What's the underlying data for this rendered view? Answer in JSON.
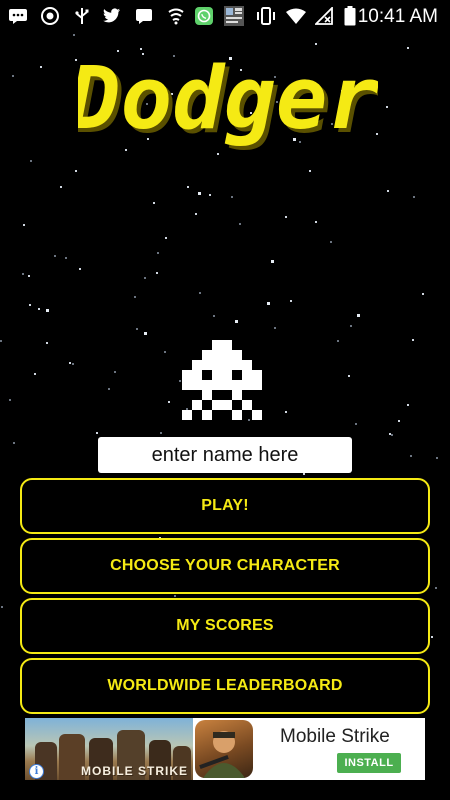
{
  "status_bar": {
    "time": "10:41 AM",
    "icons": [
      "messages-icon",
      "vpn-icon",
      "usb-icon",
      "twitter-icon",
      "chat-icon",
      "shield-icon",
      "whatsapp-icon",
      "news-icon",
      "vibrate-icon",
      "wifi-icon",
      "no-signal-icon",
      "battery-icon"
    ]
  },
  "game": {
    "title": "Dodger",
    "title_color": "#f5ea14",
    "character": "space-invader-icon"
  },
  "name_input": {
    "placeholder": "enter name here",
    "value": ""
  },
  "menu": {
    "buttons": [
      {
        "label": "PLAY!"
      },
      {
        "label": "CHOOSE YOUR CHARACTER"
      },
      {
        "label": "MY SCORES"
      },
      {
        "label": "WORLDWIDE LEADERBOARD"
      }
    ],
    "accent_color": "#f5ea14"
  },
  "ad": {
    "image_caption": "MOBILE STRIKE",
    "title": "Mobile Strike",
    "install_label": "INSTALL",
    "info_label": "i"
  }
}
